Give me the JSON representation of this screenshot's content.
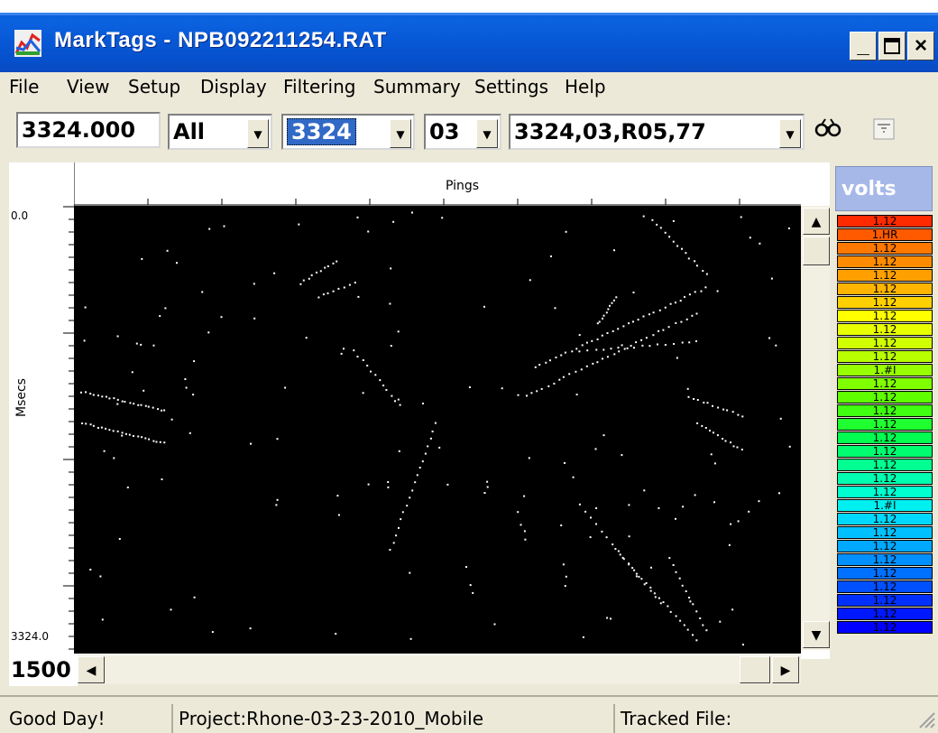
{
  "window": {
    "title": "MarkTags - NPB092211254.RAT",
    "minimize": "_",
    "close": "×"
  },
  "menu": [
    "File",
    "View",
    "Setup",
    "Display",
    "Filtering",
    "Summary",
    "Settings",
    "Help"
  ],
  "toolbar": {
    "value_field": "3324.000",
    "filter_select": "All",
    "tag_select": "3324",
    "channel_select": "03",
    "tag_code_select": "3324,03,R05,77",
    "binoculars_icon": "binoculars-icon",
    "filter_icon": "filter-icon"
  },
  "chart": {
    "x_axis_label": "Pings",
    "y_axis_label": "Msecs",
    "y_top": "0.0",
    "y_bottom": "3324.0",
    "zoom": "1500",
    "background": "#000000",
    "dot_color": "#ffffff"
  },
  "legend": {
    "title": "volts",
    "entries": [
      {
        "label": "1.12",
        "color": "#ff2a00"
      },
      {
        "label": "1.HR",
        "color": "#ff5a00"
      },
      {
        "label": "1.12",
        "color": "#ff7800"
      },
      {
        "label": "1.12",
        "color": "#ff8c00"
      },
      {
        "label": "1.12",
        "color": "#ffa000"
      },
      {
        "label": "1.12",
        "color": "#ffb400"
      },
      {
        "label": "1.12",
        "color": "#ffd000"
      },
      {
        "label": "1.12",
        "color": "#ffff00"
      },
      {
        "label": "1.12",
        "color": "#e8ff00"
      },
      {
        "label": "1.12",
        "color": "#d0ff00"
      },
      {
        "label": "1.12",
        "color": "#b8ff00"
      },
      {
        "label": "1.#I",
        "color": "#98ff00"
      },
      {
        "label": "1.12",
        "color": "#80ff00"
      },
      {
        "label": "1.12",
        "color": "#60ff00"
      },
      {
        "label": "1.12",
        "color": "#40ff10"
      },
      {
        "label": "1.12",
        "color": "#20ff30"
      },
      {
        "label": "1.12",
        "color": "#00ff50"
      },
      {
        "label": "1.12",
        "color": "#00ff70"
      },
      {
        "label": "1.12",
        "color": "#00ff90"
      },
      {
        "label": "1.12",
        "color": "#00ffb0"
      },
      {
        "label": "1.12",
        "color": "#00ffd0"
      },
      {
        "label": "1.#I",
        "color": "#00f0f0"
      },
      {
        "label": "1.12",
        "color": "#00d8ff"
      },
      {
        "label": "1.12",
        "color": "#00c0ff"
      },
      {
        "label": "1.12",
        "color": "#00a8ff"
      },
      {
        "label": "1.12",
        "color": "#0090ff"
      },
      {
        "label": "1.12",
        "color": "#0070ff"
      },
      {
        "label": "1.12",
        "color": "#0050ff"
      },
      {
        "label": "1.12",
        "color": "#0030ff"
      },
      {
        "label": "1.12",
        "color": "#0018ff"
      },
      {
        "label": "1.12",
        "color": "#0000ff"
      }
    ]
  },
  "status": {
    "greeting": "Good Day!",
    "project": "Project:Rhone-03-23-2010_Mobile",
    "tracked": "Tracked File:"
  }
}
